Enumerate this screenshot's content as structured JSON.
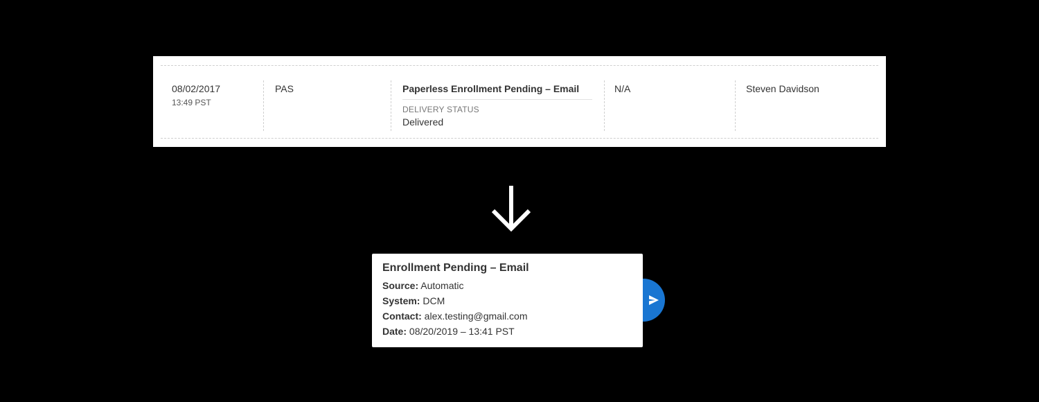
{
  "record": {
    "date": "08/02/2017",
    "time": "13:49 PST",
    "system": "PAS",
    "event_title": "Paperless Enrollment Pending – Email",
    "delivery_status_label": "DELIVERY STATUS",
    "delivery_status_value": "Delivered",
    "contact": "N/A",
    "user": "Steven Davidson"
  },
  "arrow": {
    "icon": "arrow-down-icon"
  },
  "detail": {
    "title": "Enrollment Pending – Email",
    "source_label": "Source:",
    "source_value": "Automatic",
    "system_label": "System:",
    "system_value": "DCM",
    "contact_label": "Contact:",
    "contact_value": "alex.testing@gmail.com",
    "date_label": "Date:",
    "date_value": "08/20/2019 – 13:41 PST"
  },
  "send_button": {
    "icon": "send-icon",
    "color": "#1976d2"
  }
}
